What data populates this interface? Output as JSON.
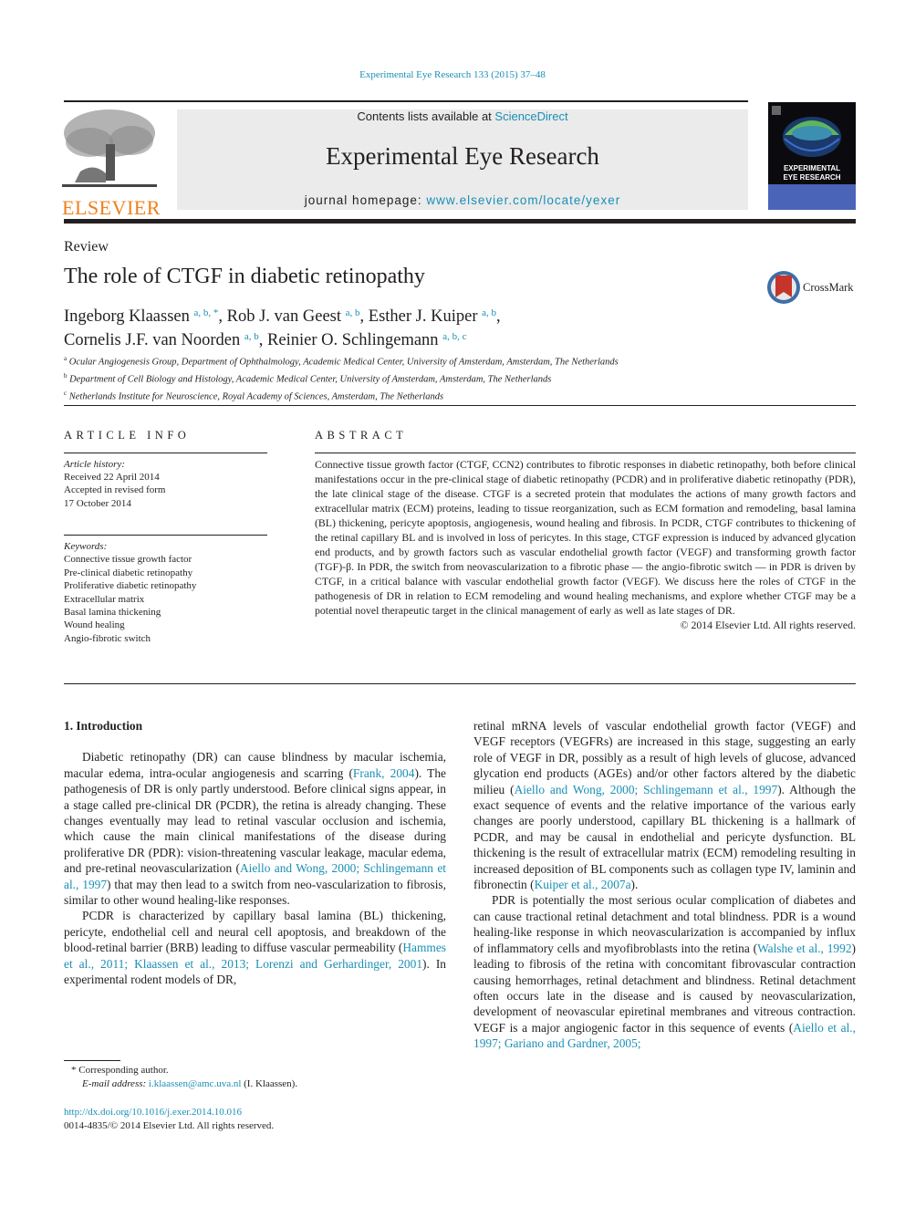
{
  "header": {
    "journal_ref": "Experimental Eye Research 133 (2015) 37–48",
    "contents_prefix": "Contents lists available at ",
    "contents_link": "ScienceDirect",
    "journal_name": "Experimental Eye Research",
    "homepage_prefix": "journal homepage: ",
    "homepage_link": "www.elsevier.com/locate/yexer",
    "publisher_logo": "ELSEVIER",
    "cover_title_line1": "EXPERIMENTAL",
    "cover_title_line2": "EYE RESEARCH",
    "colors": {
      "link": "#1a8fb5",
      "elsevier_orange": "#f07f1a",
      "banner_bg": "#ebebeb"
    }
  },
  "article": {
    "type": "Review",
    "title": "The role of CTGF in diabetic retinopathy",
    "crossmark_label": "CrossMark",
    "authors": [
      {
        "name": "Ingeborg Klaassen",
        "sup": "a, b, *",
        "sep": ", "
      },
      {
        "name": "Rob J. van Geest",
        "sup": "a, b",
        "sep": ", "
      },
      {
        "name": "Esther J. Kuiper",
        "sup": "a, b",
        "sep": ","
      },
      {
        "name": "Cornelis J.F. van Noorden",
        "sup": "a, b",
        "sep": ", "
      },
      {
        "name": "Reinier O. Schlingemann",
        "sup": "a, b, c",
        "sep": ""
      }
    ],
    "affiliations": [
      {
        "key": "a",
        "text": "Ocular Angiogenesis Group, Department of Ophthalmology, Academic Medical Center, University of Amsterdam, Amsterdam, The Netherlands"
      },
      {
        "key": "b",
        "text": "Department of Cell Biology and Histology, Academic Medical Center, University of Amsterdam, Amsterdam, The Netherlands"
      },
      {
        "key": "c",
        "text": "Netherlands Institute for Neuroscience, Royal Academy of Sciences, Amsterdam, The Netherlands"
      }
    ]
  },
  "article_info": {
    "heading": "ARTICLE INFO",
    "history_label": "Article history:",
    "history": [
      "Received 22 April 2014",
      "Accepted in revised form",
      "17 October 2014"
    ],
    "keywords_label": "Keywords:",
    "keywords": [
      "Connective tissue growth factor",
      "Pre-clinical diabetic retinopathy",
      "Proliferative diabetic retinopathy",
      "Extracellular matrix",
      "Basal lamina thickening",
      "Wound healing",
      "Angio-fibrotic switch"
    ]
  },
  "abstract": {
    "heading": "ABSTRACT",
    "text": "Connective tissue growth factor (CTGF, CCN2) contributes to fibrotic responses in diabetic retinopathy, both before clinical manifestations occur in the pre-clinical stage of diabetic retinopathy (PCDR) and in proliferative diabetic retinopathy (PDR), the late clinical stage of the disease. CTGF is a secreted protein that modulates the actions of many growth factors and extracellular matrix (ECM) proteins, leading to tissue reorganization, such as ECM formation and remodeling, basal lamina (BL) thickening, pericyte apoptosis, angiogenesis, wound healing and fibrosis. In PCDR, CTGF contributes to thickening of the retinal capillary BL and is involved in loss of pericytes. In this stage, CTGF expression is induced by advanced glycation end products, and by growth factors such as vascular endothelial growth factor (VEGF) and transforming growth factor (TGF)-β. In PDR, the switch from neovascularization to a fibrotic phase — the angio-fibrotic switch — in PDR is driven by CTGF, in a critical balance with vascular endothelial growth factor (VEGF). We discuss here the roles of CTGF in the pathogenesis of DR in relation to ECM remodeling and wound healing mechanisms, and explore whether CTGF may be a potential novel therapeutic target in the clinical management of early as well as late stages of DR.",
    "copyright": "© 2014 Elsevier Ltd. All rights reserved."
  },
  "body": {
    "section_heading": "1.  Introduction",
    "left_paragraphs": [
      [
        {
          "t": "Diabetic retinopathy (DR) can cause blindness by macular ischemia, macular edema, intra-ocular angiogenesis and scarring ("
        },
        {
          "t": "Frank, 2004",
          "link": true
        },
        {
          "t": "). The pathogenesis of DR is only partly understood. Before clinical signs appear, in a stage called pre-clinical DR (PCDR), the retina is already changing. These changes eventually may lead to retinal vascular occlusion and ischemia, which cause the main clinical manifestations of the disease during proliferative DR (PDR): vision-threatening vascular leakage, macular edema, and pre-retinal neovascularization ("
        },
        {
          "t": "Aiello and Wong, 2000; Schlingemann et al., 1997",
          "link": true
        },
        {
          "t": ") that may then lead to a switch from neo-vascularization to fibrosis, similar to other wound healing-like responses."
        }
      ],
      [
        {
          "t": "PCDR is characterized by capillary basal lamina (BL) thickening, pericyte, endothelial cell and neural cell apoptosis, and breakdown of the blood-retinal barrier (BRB) leading to diffuse vascular permeability ("
        },
        {
          "t": "Hammes et al., 2011; Klaassen et al., 2013; Lorenzi and Gerhardinger, 2001",
          "link": true
        },
        {
          "t": "). In experimental rodent models of DR,"
        }
      ]
    ],
    "right_paragraphs": [
      [
        {
          "t": "retinal mRNA levels of vascular endothelial growth factor (VEGF) and VEGF receptors (VEGFRs) are increased in this stage, suggesting an early role of VEGF in DR, possibly as a result of high levels of glucose, advanced glycation end products (AGEs) and/or other factors altered by the diabetic milieu ("
        },
        {
          "t": "Aiello and Wong, 2000; Schlingemann et al., 1997",
          "link": true
        },
        {
          "t": "). Although the exact sequence of events and the relative importance of the various early changes are poorly understood, capillary BL thickening is a hallmark of PCDR, and may be causal in endothelial and pericyte dysfunction. BL thickening is the result of extracellular matrix (ECM) remodeling resulting in increased deposition of BL components such as collagen type IV, laminin and fibronectin ("
        },
        {
          "t": "Kuiper et al., 2007a",
          "link": true
        },
        {
          "t": ")."
        }
      ],
      [
        {
          "t": "PDR is potentially the most serious ocular complication of diabetes and can cause tractional retinal detachment and total blindness. PDR is a wound healing-like response in which neovascularization is accompanied by influx of inflammatory cells and myofibroblasts into the retina ("
        },
        {
          "t": "Walshe et al., 1992",
          "link": true
        },
        {
          "t": ") leading to fibrosis of the retina with concomitant fibrovascular contraction causing hemorrhages, retinal detachment and blindness. Retinal detachment often occurs late in the disease and is caused by neovascularization, development of neovascular epiretinal membranes and vitreous contraction. VEGF is a major angiogenic factor in this sequence of events ("
        },
        {
          "t": "Aiello et al., 1997; Gariano and Gardner, 2005;",
          "link": true
        }
      ]
    ]
  },
  "footer": {
    "corresponding_label": "* Corresponding author.",
    "email_label": "E-mail address: ",
    "email": "i.klaassen@amc.uva.nl",
    "email_suffix": " (I. Klaassen).",
    "doi": "http://dx.doi.org/10.1016/j.exer.2014.10.016",
    "issn_copyright": "0014-4835/© 2014 Elsevier Ltd. All rights reserved."
  }
}
